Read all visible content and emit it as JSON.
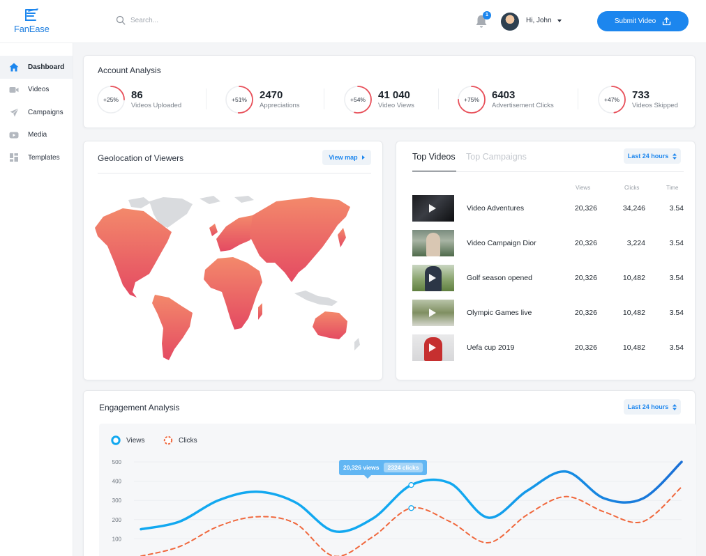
{
  "app": {
    "name": "FanEase"
  },
  "header": {
    "search_placeholder": "Search...",
    "notification_count": "1",
    "user_greeting": "Hi, John",
    "submit_label": "Submit Video"
  },
  "sidebar": {
    "items": [
      {
        "label": "Dashboard",
        "icon": "home-icon",
        "active": true
      },
      {
        "label": "Videos",
        "icon": "video-camera-icon"
      },
      {
        "label": "Campaigns",
        "icon": "megaphone-icon"
      },
      {
        "label": "Media",
        "icon": "play-icon"
      },
      {
        "label": "Templates",
        "icon": "grid-icon"
      }
    ]
  },
  "account": {
    "title": "Account Analysis",
    "stats": [
      {
        "pct": "+25%",
        "pct_value": 25,
        "value": "86",
        "label": "Videos Uploaded"
      },
      {
        "pct": "+51%",
        "pct_value": 51,
        "value": "2470",
        "label": "Appreciations"
      },
      {
        "pct": "+54%",
        "pct_value": 54,
        "value": "41 040",
        "label": "Video Views"
      },
      {
        "pct": "+75%",
        "pct_value": 75,
        "value": "6403",
        "label": "Advertisement Clicks"
      },
      {
        "pct": "+47%",
        "pct_value": 47,
        "value": "733",
        "label": "Videos Skipped"
      }
    ]
  },
  "geo": {
    "title": "Geolocation of Viewers",
    "view_map_label": "View map"
  },
  "top_videos": {
    "tabs": [
      "Top Videos",
      "Top Campaigns"
    ],
    "range_label": "Last 24 hours",
    "columns": [
      "Views",
      "Clicks",
      "Time"
    ],
    "rows": [
      {
        "name": "Video Adventures",
        "views": "20,326",
        "clicks": "34,246",
        "time": "3.54"
      },
      {
        "name": "Video Campaign Dior",
        "views": "20,326",
        "clicks": "3,224",
        "time": "3.54"
      },
      {
        "name": "Golf season opened",
        "views": "20,326",
        "clicks": "10,482",
        "time": "3.54"
      },
      {
        "name": "Olympic Games live",
        "views": "20,326",
        "clicks": "10,482",
        "time": "3.54"
      },
      {
        "name": "Uefa cup 2019",
        "views": "20,326",
        "clicks": "10,482",
        "time": "3.54"
      }
    ]
  },
  "engagement": {
    "title": "Engagement Analysis",
    "range_label": "Last 24 hours",
    "legend": [
      "Views",
      "Clicks"
    ],
    "tooltip_views": "20,326 views",
    "tooltip_clicks": "2324 clicks",
    "colors": {
      "views": "#12a8f0",
      "clicks": "#f0673c"
    }
  },
  "chart_data": {
    "type": "line",
    "y_ticks": [
      100,
      200,
      300,
      400,
      500
    ],
    "ylim": [
      0,
      500
    ],
    "xlim": [
      0,
      14
    ],
    "series": [
      {
        "name": "Views",
        "x": [
          0,
          1,
          2,
          3,
          4,
          5,
          6,
          7,
          8,
          9,
          10,
          11,
          12,
          13,
          14
        ],
        "values": [
          150,
          190,
          300,
          345,
          290,
          140,
          205,
          380,
          390,
          210,
          350,
          450,
          310,
          310,
          500
        ]
      },
      {
        "name": "Clicks",
        "x": [
          0,
          1,
          2,
          3,
          4,
          5,
          6,
          7,
          8,
          9,
          10,
          11,
          12,
          13,
          14
        ],
        "values": [
          10,
          60,
          165,
          215,
          180,
          10,
          110,
          260,
          190,
          80,
          225,
          320,
          240,
          190,
          370
        ]
      }
    ]
  }
}
